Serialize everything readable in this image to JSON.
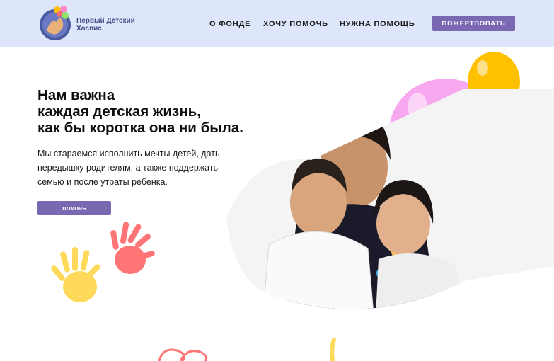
{
  "header": {
    "logo_text": [
      "Первый Детский",
      "Хоспис"
    ],
    "nav": [
      "О ФОНДЕ",
      "ХОЧУ ПОМОЧЬ",
      "НУЖНА ПОМОЩЬ"
    ],
    "donate_label": "ПОЖЕРТВОВАТЬ"
  },
  "hero": {
    "title_lines": [
      "Нам важна",
      "каждая детская жизнь,",
      "как бы коротка она ни была."
    ],
    "text_lines": [
      "Мы стараемся исполнить мечты детей, дать",
      "передышку родителям, а также поддержать",
      "семью и после утраты ребенка."
    ],
    "help_label": "помочь"
  },
  "colors": {
    "header_bg": "#dde6fa",
    "accent": "#7a68b3",
    "logo_text": "#4a4f86",
    "balloon_pink": "#f7a8ee",
    "balloon_yellow": "#ffc000",
    "balloon_green": "#a6ea7c",
    "hand_red": "#ff7575",
    "hand_yellow": "#ffd95a"
  },
  "icons": {
    "logo": "hospice-logo-icon",
    "hands": "handprints-icon"
  }
}
